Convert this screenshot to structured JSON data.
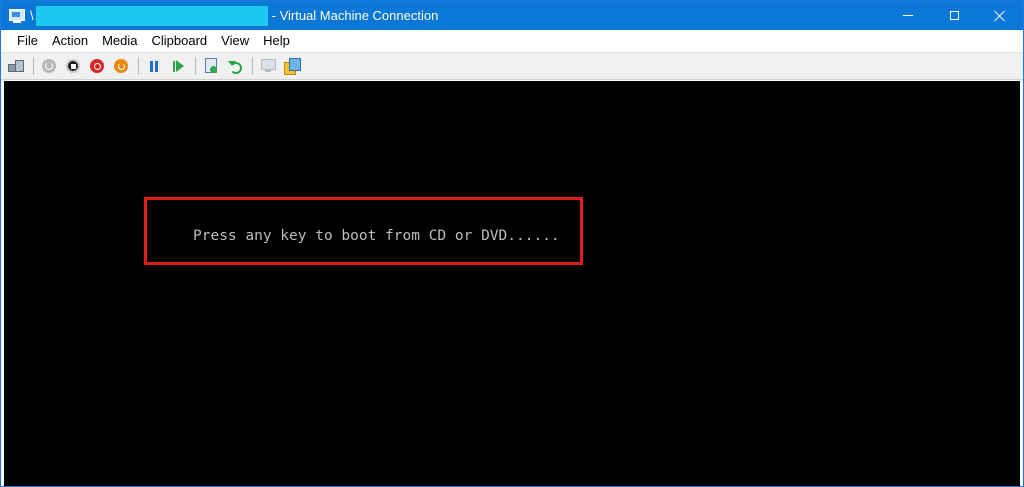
{
  "window": {
    "title_prefix": "\\",
    "title": "- Virtual Machine Connection",
    "redacted_color": "#1ec8f0",
    "accent": "#0b78d7"
  },
  "menu": {
    "items": [
      "File",
      "Action",
      "Media",
      "Clipboard",
      "View",
      "Help"
    ]
  },
  "toolbar": {
    "icons": [
      "ctrl-alt-del-icon",
      "start-icon",
      "turn-off-icon",
      "shut-down-icon",
      "save-icon",
      "pause-icon",
      "resume-icon",
      "checkpoint-icon",
      "revert-icon",
      "enhanced-session-icon",
      "share-icon"
    ]
  },
  "screen": {
    "boot_message": "Press any key to boot from CD or DVD......",
    "highlight_color": "#e11c1c"
  }
}
